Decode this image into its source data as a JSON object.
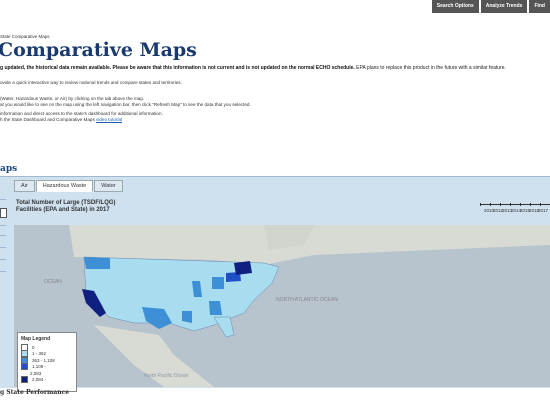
{
  "topnav": [
    "Search Options",
    "Analyze Trends",
    "Find"
  ],
  "breadcrumb": "State Comparative Maps",
  "page_title": "Comparative Maps",
  "notice": {
    "bold": "g updated, the historical data remain available. Please be aware that this information is not current and is not updated on the normal ECHO schedule.",
    "rest": " EPA plans to replace this product in the future with a similar feature."
  },
  "paragraphs": [
    "ovide a quick interactive way to review national trends and compare states and territories.",
    "(Water, Hazardous Waste, or Air) by clicking on the tab above the map.",
    "at you would like to see on the map using the left navigation bar, then click \"Refresh Map\" to see the data that you selected.",
    "information and direct access to the state's dashboard for additional information.",
    "h the State Dashboard and Comparative Maps "
  ],
  "video_link": "video tutorial",
  "section_title": "aps",
  "tabs": [
    "Air",
    "Hazardous Waste",
    "Water"
  ],
  "active_tab": "Hazardous Waste",
  "map_title_line1": "Total Number of Large (TSDF/LQG)",
  "map_title_line2": "Facilities (EPA and State) in 2017",
  "year_labels": [
    "2010",
    "2012",
    "2013",
    "2014",
    "2015",
    "2016",
    "2017"
  ],
  "ocean_labels": [
    "OCEAN",
    "NORTH ATLANTIC OCEAN",
    "North Pacific Ocean"
  ],
  "legend": {
    "title": "Map Legend",
    "items": [
      {
        "label": "0",
        "color": "#ffffff"
      },
      {
        "label": "1 - 362",
        "color": "#a8dcef"
      },
      {
        "label": "363 - 1,108",
        "color": "#3d8fd6"
      },
      {
        "label": "1,109 -",
        "color": "#1f4fc8"
      },
      {
        "label": "2,083",
        "color": ""
      },
      {
        "label": "2,084 -",
        "color": "#102080"
      }
    ]
  },
  "bottom_title": "g State Performance",
  "colors": {
    "title": "#1a3a6e",
    "nav_bg": "#555555",
    "map_bg": "#b7c3cd"
  }
}
